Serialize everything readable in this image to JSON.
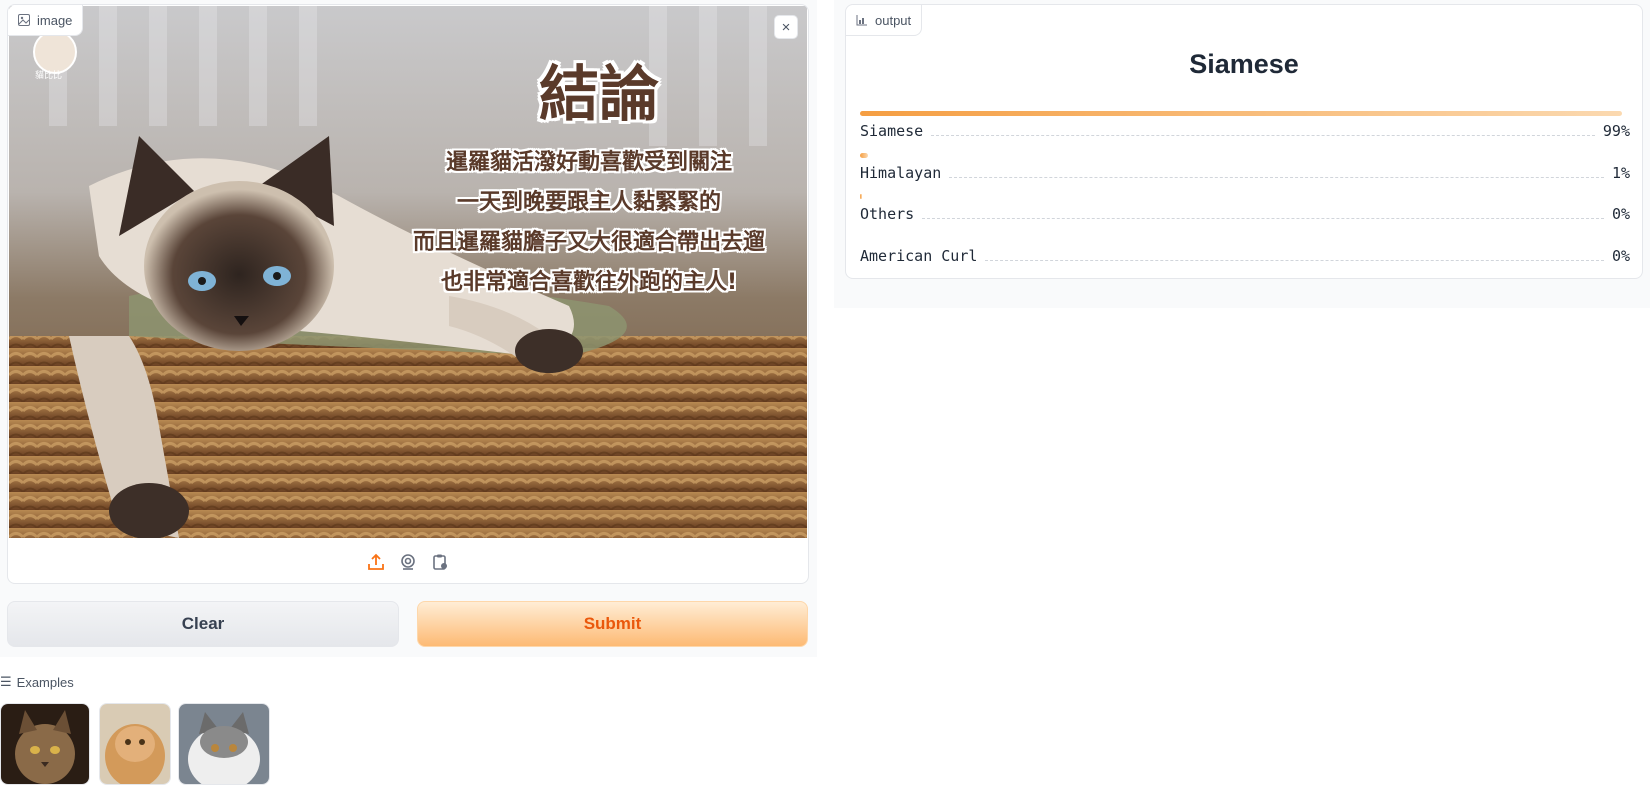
{
  "input": {
    "label": "image",
    "overlay_title": "結論",
    "overlay_lines": [
      "暹羅貓活潑好動喜歡受到關注",
      "一天到晚要跟主人黏緊緊的",
      "而且暹羅貓膽子又大很適合帶出去遛",
      "也非常適合喜歡往外跑的主人!"
    ],
    "watermark": "貓比比",
    "close": "×",
    "sources": [
      {
        "icon": "upload-icon"
      },
      {
        "icon": "webcam-icon"
      },
      {
        "icon": "clipboard-icon"
      }
    ]
  },
  "actions": {
    "clear_label": "Clear",
    "submit_label": "Submit"
  },
  "output": {
    "label": "output",
    "top_class": "Siamese",
    "confidences": [
      {
        "label": "Siamese",
        "percent": "99%",
        "fraction": 0.99
      },
      {
        "label": "Himalayan",
        "percent": "1%",
        "fraction": 0.01
      },
      {
        "label": "Others",
        "percent": "0%",
        "fraction": 0.002
      },
      {
        "label": "American Curl",
        "percent": "0%",
        "fraction": 0.0
      }
    ]
  },
  "examples": {
    "label": "Examples",
    "items": [
      {
        "name": "maine-coon-thumb"
      },
      {
        "name": "persian-cat-thumb"
      },
      {
        "name": "ragdoll-cat-thumb"
      }
    ]
  },
  "colors": {
    "accent": "#f97316",
    "submit_gradient_start": "#ffedd5",
    "submit_gradient_end": "#fdba74",
    "bar_start": "#f59e42",
    "bar_end": "#fbd9b0"
  }
}
